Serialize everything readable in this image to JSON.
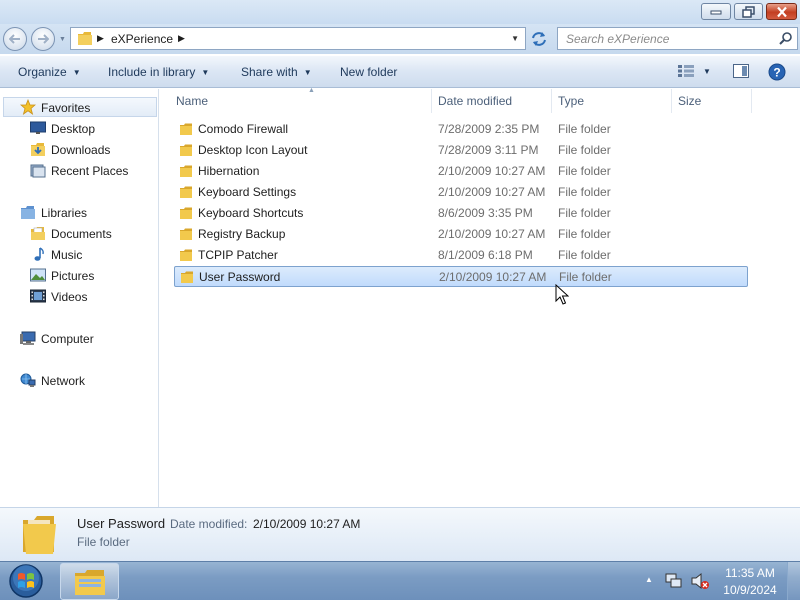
{
  "window": {
    "controls": [
      "minimize-button",
      "maximize-button",
      "close-button"
    ]
  },
  "address": {
    "crumb": "eXPerience",
    "search_placeholder": "Search eXPerience"
  },
  "toolbar": {
    "organize": "Organize",
    "include_in_library": "Include in library",
    "share_with": "Share with",
    "new_folder": "New folder"
  },
  "nav": {
    "favorites": "Favorites",
    "desktop": "Desktop",
    "downloads": "Downloads",
    "recent_places": "Recent Places",
    "libraries": "Libraries",
    "documents": "Documents",
    "music": "Music",
    "pictures": "Pictures",
    "videos": "Videos",
    "computer": "Computer",
    "network": "Network"
  },
  "columns": {
    "name": "Name",
    "date_modified": "Date modified",
    "type": "Type",
    "size": "Size"
  },
  "files": [
    {
      "name": "Comodo Firewall",
      "date": "7/28/2009 2:35 PM",
      "type": "File folder"
    },
    {
      "name": "Desktop Icon Layout",
      "date": "7/28/2009 3:11 PM",
      "type": "File folder"
    },
    {
      "name": "Hibernation",
      "date": "2/10/2009 10:27 AM",
      "type": "File folder"
    },
    {
      "name": "Keyboard Settings",
      "date": "2/10/2009 10:27 AM",
      "type": "File folder"
    },
    {
      "name": "Keyboard Shortcuts",
      "date": "8/6/2009 3:35 PM",
      "type": "File folder"
    },
    {
      "name": "Registry Backup",
      "date": "2/10/2009 10:27 AM",
      "type": "File folder"
    },
    {
      "name": "TCPIP Patcher",
      "date": "8/1/2009 6:18 PM",
      "type": "File folder"
    },
    {
      "name": "User Password",
      "date": "2/10/2009 10:27 AM",
      "type": "File folder",
      "selected": true
    }
  ],
  "details": {
    "name": "User Password",
    "date_label": "Date modified:",
    "date_value": "2/10/2009 10:27 AM",
    "type": "File folder"
  },
  "taskbar": {
    "time": "11:35 AM",
    "date": "10/9/2024"
  },
  "colors": {
    "selection": "#cce4fc",
    "selection_border": "#7da2ce",
    "folder_yellow": "#f0c64a",
    "taskbar": "#7b9cc3"
  }
}
